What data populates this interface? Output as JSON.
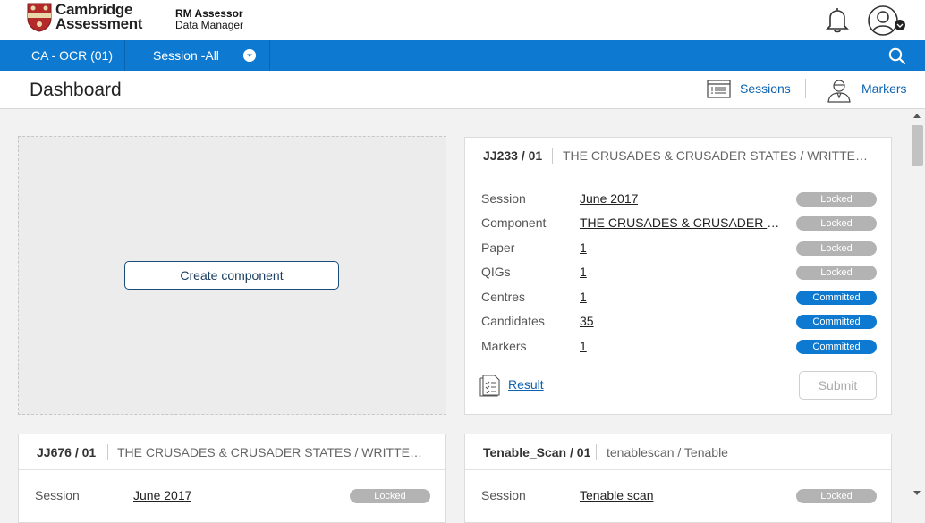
{
  "brand": {
    "line1": "Cambridge",
    "line2": "Assessment",
    "product_line1": "RM Assessor",
    "product_line2": "Data Manager"
  },
  "header_icons": [
    "bell-icon",
    "user-avatar-icon"
  ],
  "nav": {
    "org": "CA - OCR (01)",
    "session": "Session -All"
  },
  "page": {
    "title": "Dashboard",
    "links": {
      "sessions": "Sessions",
      "markers": "Markers"
    }
  },
  "create": {
    "button": "Create component"
  },
  "cards": [
    {
      "code": "JJ233 / 01",
      "name": "THE CRUSADES & CRUSADER STATES / WRITTEN PA...",
      "rows": [
        {
          "label": "Session",
          "value": "June 2017",
          "status": "Locked"
        },
        {
          "label": "Component",
          "value": "THE CRUSADES & CRUSADER STA...",
          "status": "Locked"
        },
        {
          "label": "Paper",
          "value": "1",
          "status": "Locked"
        },
        {
          "label": "QIGs",
          "value": "1",
          "status": "Locked"
        },
        {
          "label": "Centres",
          "value": "1",
          "status": "Committed"
        },
        {
          "label": "Candidates",
          "value": "35",
          "status": "Committed"
        },
        {
          "label": "Markers",
          "value": "1",
          "status": "Committed"
        }
      ],
      "result": "Result",
      "submit": "Submit"
    },
    {
      "code": "JJ676 / 01",
      "name": "THE CRUSADES & CRUSADER STATES / WRITTEN PA...",
      "rows": [
        {
          "label": "Session",
          "value": "June 2017",
          "status": "Locked"
        }
      ]
    },
    {
      "code": "Tenable_Scan / 01",
      "name": "tenablescan / Tenable",
      "rows": [
        {
          "label": "Session",
          "value": "Tenable scan",
          "status": "Locked"
        }
      ]
    }
  ],
  "colors": {
    "accent": "#0e79d0",
    "locked": "#b3b3b3",
    "committed": "#0e79d0"
  }
}
